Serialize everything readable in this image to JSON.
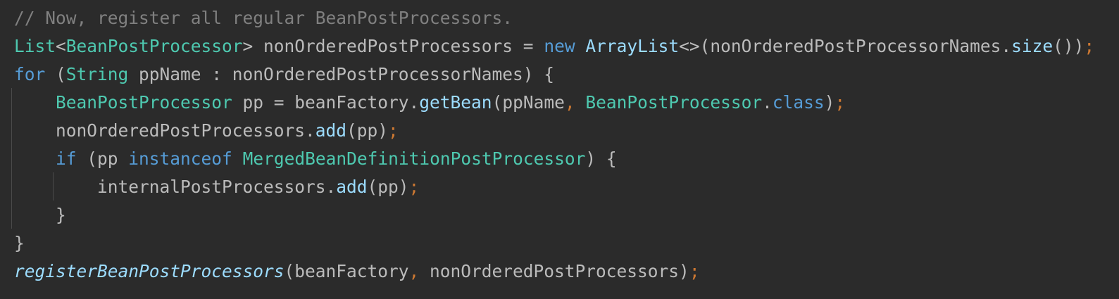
{
  "theme": {
    "background": "#2b2b2b",
    "default_text": "#bbbbbb",
    "comment": "#808080",
    "type": "#4ec9b0",
    "keyword": "#569cd6",
    "method": "#9cdcfe",
    "semicolon": "#cc7832",
    "indent_guide": "#4a4a4a"
  },
  "code": {
    "lines": [
      [
        {
          "t": "// Now, register all regular BeanPostProcessors.",
          "c": "comment"
        }
      ],
      [
        {
          "t": "List",
          "c": "type"
        },
        {
          "t": "<",
          "c": "punct"
        },
        {
          "t": "BeanPostProcessor",
          "c": "type"
        },
        {
          "t": "> nonOrderedPostProcessors = ",
          "c": "ident"
        },
        {
          "t": "new",
          "c": "keyword"
        },
        {
          "t": " ",
          "c": "ident"
        },
        {
          "t": "ArrayList",
          "c": "method"
        },
        {
          "t": "<>(nonOrderedPostProcessorNames.",
          "c": "ident"
        },
        {
          "t": "size",
          "c": "method"
        },
        {
          "t": "())",
          "c": "punct"
        },
        {
          "t": ";",
          "c": "semi"
        }
      ],
      [
        {
          "t": "for",
          "c": "keyword"
        },
        {
          "t": " (",
          "c": "punct"
        },
        {
          "t": "String",
          "c": "type"
        },
        {
          "t": " ppName : nonOrderedPostProcessorNames) {",
          "c": "ident"
        }
      ],
      [
        {
          "t": "    ",
          "c": "ident"
        },
        {
          "t": "BeanPostProcessor",
          "c": "type"
        },
        {
          "t": " pp = beanFactory.",
          "c": "ident"
        },
        {
          "t": "getBean",
          "c": "method"
        },
        {
          "t": "(ppName",
          "c": "ident"
        },
        {
          "t": ",",
          "c": "semi"
        },
        {
          "t": " ",
          "c": "ident"
        },
        {
          "t": "BeanPostProcessor",
          "c": "type"
        },
        {
          "t": ".",
          "c": "punct"
        },
        {
          "t": "class",
          "c": "keyword"
        },
        {
          "t": ")",
          "c": "punct"
        },
        {
          "t": ";",
          "c": "semi"
        }
      ],
      [
        {
          "t": "    nonOrderedPostProcessors.",
          "c": "ident"
        },
        {
          "t": "add",
          "c": "method"
        },
        {
          "t": "(pp)",
          "c": "punct"
        },
        {
          "t": ";",
          "c": "semi"
        }
      ],
      [
        {
          "t": "    ",
          "c": "ident"
        },
        {
          "t": "if",
          "c": "keyword"
        },
        {
          "t": " (pp ",
          "c": "ident"
        },
        {
          "t": "instanceof",
          "c": "keyword"
        },
        {
          "t": " ",
          "c": "ident"
        },
        {
          "t": "MergedBeanDefinitionPostProcessor",
          "c": "type"
        },
        {
          "t": ") {",
          "c": "punct"
        }
      ],
      [
        {
          "t": "        internalPostProcessors.",
          "c": "ident"
        },
        {
          "t": "add",
          "c": "method"
        },
        {
          "t": "(pp)",
          "c": "punct"
        },
        {
          "t": ";",
          "c": "semi"
        }
      ],
      [
        {
          "t": "    }",
          "c": "punct"
        }
      ],
      [
        {
          "t": "}",
          "c": "punct"
        }
      ],
      [
        {
          "t": "registerBeanPostProcessors",
          "c": "italic"
        },
        {
          "t": "(beanFactory",
          "c": "ident"
        },
        {
          "t": ",",
          "c": "semi"
        },
        {
          "t": " nonOrderedPostProcessors)",
          "c": "ident"
        },
        {
          "t": ";",
          "c": "semi"
        }
      ]
    ]
  }
}
